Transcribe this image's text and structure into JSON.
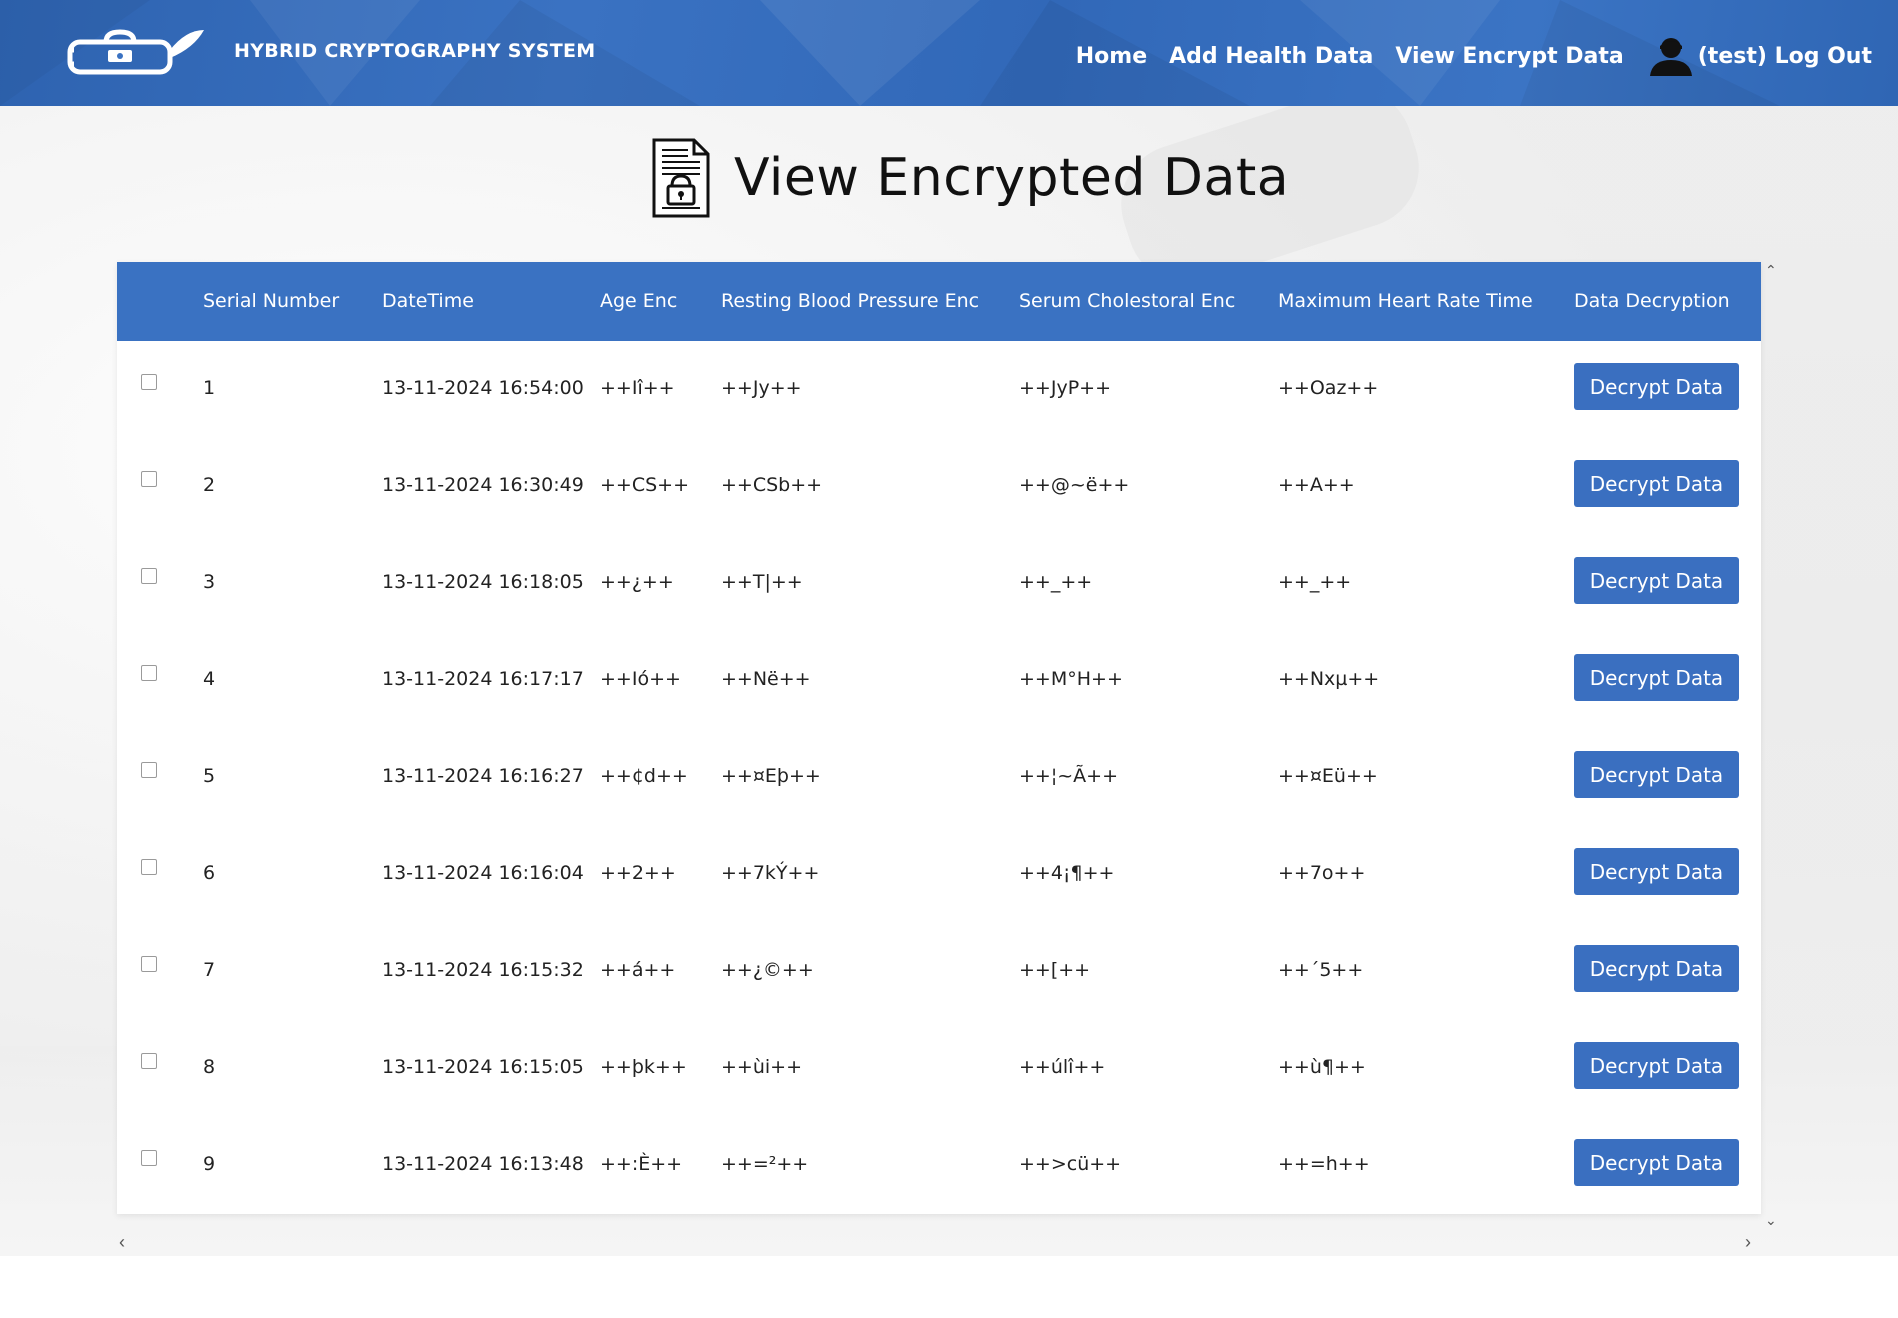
{
  "header": {
    "brand": "HYBRID CRYPTOGRAPHY SYSTEM",
    "nav": [
      {
        "label": "Home"
      },
      {
        "label": "Add Health Data"
      },
      {
        "label": "View Encrypt Data"
      }
    ],
    "user_label": "(test) Log Out",
    "color": "#3a72c2"
  },
  "page": {
    "title": "View Encrypted Data"
  },
  "table": {
    "columns": [
      "Serial Number",
      "DateTime",
      "Age Enc",
      "Resting Blood Pressure Enc",
      "Serum Cholestoral Enc",
      "Maximum Heart Rate Time",
      "Data Decryption"
    ],
    "button_label": "Decrypt Data",
    "rows": [
      {
        "serial": "1",
        "datetime": "13-11-2024 16:54:00",
        "age": "++Iî++",
        "bp": "++Jy++",
        "chol": "++JyP++",
        "hr": "++Oaz++"
      },
      {
        "serial": "2",
        "datetime": "13-11-2024 16:30:49",
        "age": "++CS++",
        "bp": "++CSb++",
        "chol": "++@~ë++",
        "hr": "++A++"
      },
      {
        "serial": "3",
        "datetime": "13-11-2024 16:18:05",
        "age": "++¿++",
        "bp": "++T|++",
        "chol": "++_++",
        "hr": "++_++"
      },
      {
        "serial": "4",
        "datetime": "13-11-2024 16:17:17",
        "age": "++Ió++",
        "bp": "++Në++",
        "chol": "++M°H++",
        "hr": "++Nxµ++"
      },
      {
        "serial": "5",
        "datetime": "13-11-2024 16:16:27",
        "age": "++¢d++",
        "bp": "++¤Eþ++",
        "chol": "++¦~Ã++",
        "hr": "++¤Eü++"
      },
      {
        "serial": "6",
        "datetime": "13-11-2024 16:16:04",
        "age": "++2++",
        "bp": "++7kÝ++",
        "chol": "++4¡¶++",
        "hr": "++7o++"
      },
      {
        "serial": "7",
        "datetime": "13-11-2024 16:15:32",
        "age": "++á++",
        "bp": "++¿©++",
        "chol": "++[++",
        "hr": "++´5++"
      },
      {
        "serial": "8",
        "datetime": "13-11-2024 16:15:05",
        "age": "++þk++",
        "bp": "++ùi++",
        "chol": "++úlî++",
        "hr": "++ù¶++"
      },
      {
        "serial": "9",
        "datetime": "13-11-2024 16:13:48",
        "age": "++:È++",
        "bp": "++=²++",
        "chol": "++>cü++",
        "hr": "++=h++"
      }
    ]
  }
}
